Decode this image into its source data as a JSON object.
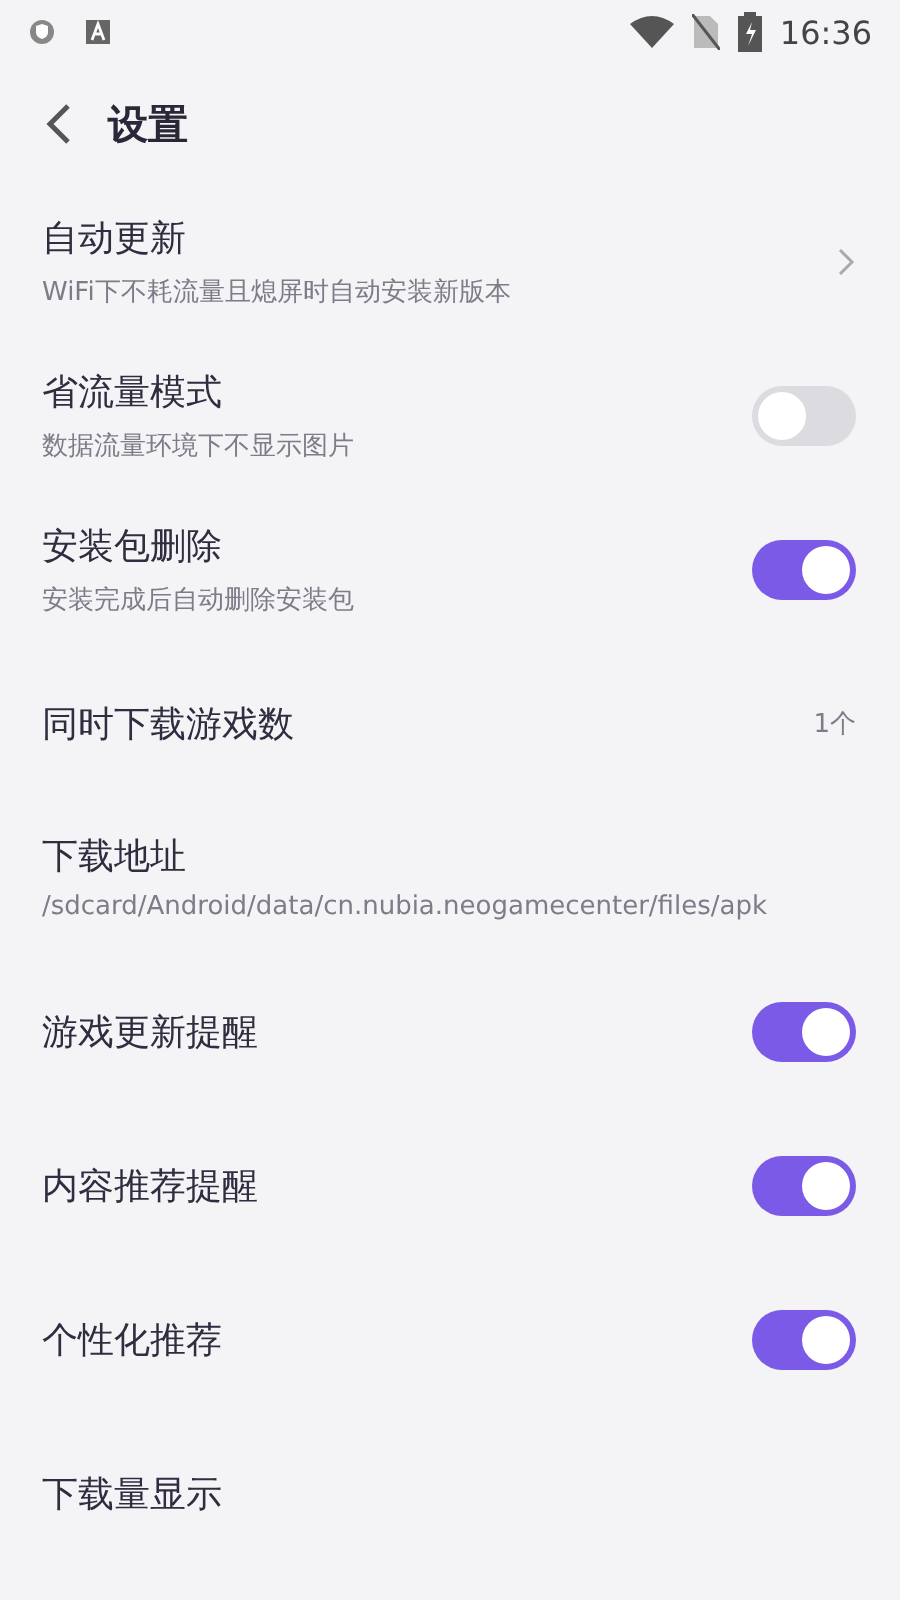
{
  "status_bar": {
    "time": "16:36"
  },
  "header": {
    "title": "设置"
  },
  "settings": [
    {
      "kind": "chevron",
      "title": "自动更新",
      "subtitle": "WiFi下不耗流量且熄屏时自动安装新版本"
    },
    {
      "kind": "toggle",
      "title": "省流量模式",
      "subtitle": "数据流量环境下不显示图片",
      "on": false
    },
    {
      "kind": "toggle",
      "title": "安装包删除",
      "subtitle": "安装完成后自动删除安装包",
      "on": true
    },
    {
      "kind": "value",
      "title": "同时下载游戏数",
      "value": "1个"
    },
    {
      "kind": "plain",
      "title": "下载地址",
      "subtitle": "/sdcard/Android/data/cn.nubia.neogamecenter/files/apk"
    },
    {
      "kind": "toggle",
      "title": "游戏更新提醒",
      "on": true
    },
    {
      "kind": "toggle",
      "title": "内容推荐提醒",
      "on": true
    },
    {
      "kind": "toggle",
      "title": "个性化推荐",
      "on": true
    },
    {
      "kind": "plain",
      "title": "下载量显示"
    }
  ]
}
